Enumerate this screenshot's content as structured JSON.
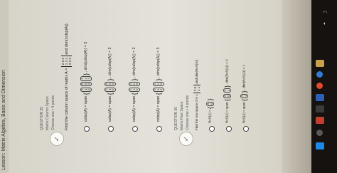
{
  "lesson_title": "Lesson: Matrix Algebra, Basis and Dimension",
  "question1": {
    "label": "QUESTION 35",
    "subtitle": "Matrix Column Space",
    "points": "Choose one • 4 points",
    "prompt": "Find the column space of matrix A = ",
    "prompt_tail": " and dim(colsp(A))",
    "matrix_rows": [
      "2 0 2",
      "1 3 1",
      "3 3 3"
    ],
    "options": [
      {
        "prefix": "colsp(A) = span",
        "tail": ", dim(colsp(A)) = 3"
      },
      {
        "prefix": "colsp(A) = span",
        "tail": ", dim(colsp(A)) = 2"
      },
      {
        "prefix": "colsp(A) = span",
        "tail": ", dim(colsp(A)) = 2"
      },
      {
        "prefix": "colsp(A) = span",
        "tail": ", dim(colsp(A)) = 3"
      }
    ]
  },
  "question2": {
    "label": "QUESTION 36",
    "subtitle": "Matrix Row Space",
    "points": "Choose one • 4 points",
    "prompt": "Find the row space of A = ",
    "prompt_tail": " and dim(RoS(A))",
    "options": [
      {
        "prefix": "RoS(A) =",
        "tail": ""
      },
      {
        "prefix": "RoS(A) = span",
        "tail": ", dim(RoS(A)) = 2"
      },
      {
        "prefix": "RoS(A) = span",
        "tail": ", dim(RoS(A)) = 1"
      }
    ]
  },
  "colors": {
    "screen": "#e4e2da",
    "taskbar": "#15120f"
  }
}
